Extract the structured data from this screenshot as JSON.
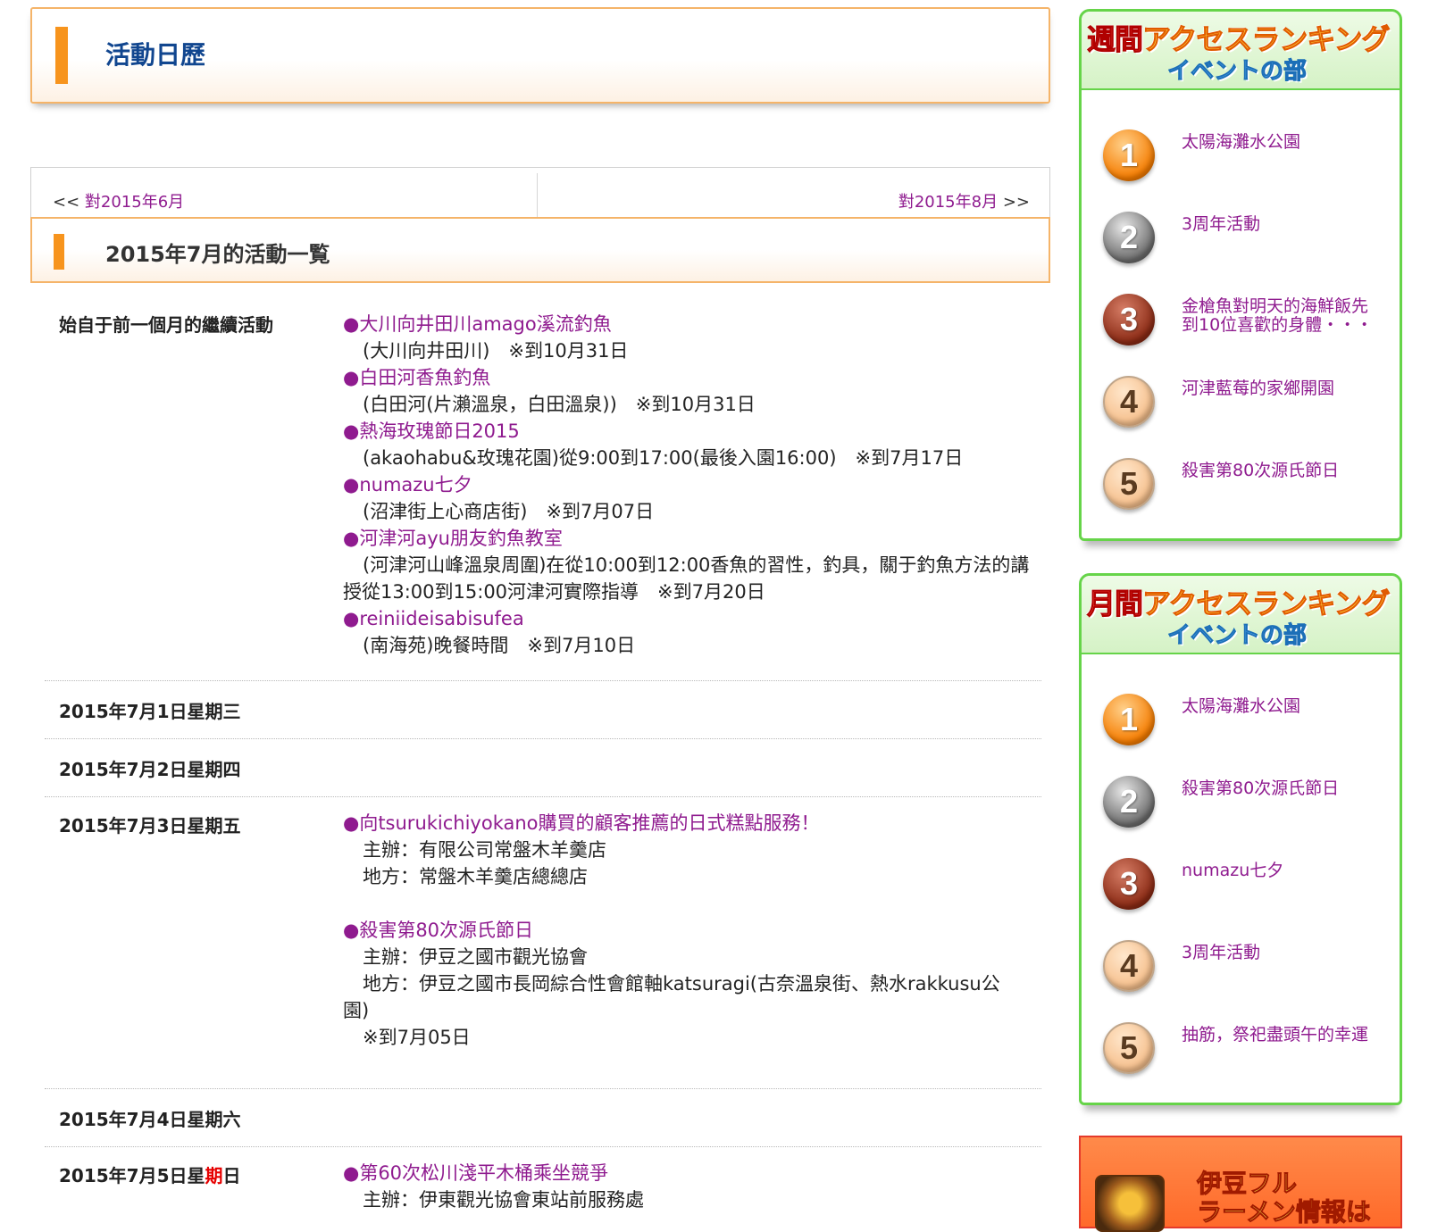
{
  "header": {
    "title": "活動日歷"
  },
  "nav": {
    "prev_arrow": "<<",
    "prev_label": "對2015年6月",
    "next_label": "對2015年8月",
    "next_arrow": ">>"
  },
  "month_heading": "2015年7月的活動一覧",
  "continuing": {
    "label": "始自于前一個月的繼續活動",
    "events": [
      {
        "title": "●大川向井田川amago溪流釣魚",
        "detail": "(大川向井田川)　※到10月31日"
      },
      {
        "title": "●白田河香魚釣魚",
        "detail": "(白田河(片瀨溫泉，白田溫泉))　※到10月31日"
      },
      {
        "title": "●熱海玫瑰節日2015",
        "detail": "(akaohabu&玫瑰花園)從9:00到17:00(最後入園16:00)　※到7月17日"
      },
      {
        "title": "●numazu七夕",
        "detail": "(沼津街上心商店街)　※到7月07日"
      },
      {
        "title": "●河津河ayu朋友釣魚教室",
        "detail": "(河津河山峰溫泉周圍)在從10:00到12:00香魚的習性，釣具，關于釣魚方法的講授從13:00到15:00河津河實際指導　※到7月20日"
      },
      {
        "title": "●reiniideisabisufea",
        "detail": "(南海苑)晚餐時間　※到7月10日"
      }
    ]
  },
  "days": [
    {
      "label": "2015年7月1日星期三"
    },
    {
      "label": "2015年7月2日星期四"
    },
    {
      "label": "2015年7月3日星期五",
      "events": [
        {
          "title": "●向tsurukichiyokano購買的顧客推薦的日式糕點服務！",
          "host": "主辦：有限公司常盤木羊羹店",
          "place": "地方：常盤木羊羹店總總店"
        },
        {
          "title": "●殺害第80次源氏節日",
          "host": "主辦：伊豆之國市觀光協會",
          "place": "地方：伊豆之國市長岡綜合性會館軸katsuragi(古奈溫泉街、熱水rakkusu公園)",
          "note": "※到7月05日"
        }
      ]
    },
    {
      "label": "2015年7月4日星期六"
    },
    {
      "label_pre": "2015年7月5日星",
      "label_red": "期",
      "label_post": "日",
      "events": [
        {
          "title": "●第60次松川淺平木桶乘坐競爭",
          "host": "主辦：伊東觀光協會東站前服務處"
        }
      ]
    }
  ],
  "weekly_ranking": {
    "heading_red": "週間",
    "heading_rest": "アクセスランキング",
    "subheading": "イベントの部",
    "items": [
      {
        "rank": "1",
        "title": "太陽海灘水公園"
      },
      {
        "rank": "2",
        "title": "3周年活動"
      },
      {
        "rank": "3",
        "title": "金槍魚對明天的海鮮飯先到10位喜歡的身體・・・"
      },
      {
        "rank": "4",
        "title": "河津藍莓的家鄉開園"
      },
      {
        "rank": "5",
        "title": "殺害第80次源氏節日"
      }
    ]
  },
  "monthly_ranking": {
    "heading_red": "月間",
    "heading_rest": "アクセスランキング",
    "subheading": "イベントの部",
    "items": [
      {
        "rank": "1",
        "title": "太陽海灘水公園"
      },
      {
        "rank": "2",
        "title": "殺害第80次源氏節日"
      },
      {
        "rank": "3",
        "title": "numazu七夕"
      },
      {
        "rank": "4",
        "title": "3周年活動"
      },
      {
        "rank": "5",
        "title": "抽筋，祭祀盡頭午的幸運"
      }
    ]
  },
  "banner": {
    "line1": "伊豆フル",
    "line2": "ラーメン情報は"
  },
  "colors": {
    "accent_orange": "#f7941d",
    "link_purple": "#8f1b8f",
    "title_blue": "#11468f",
    "ranking_green": "#66d449"
  }
}
